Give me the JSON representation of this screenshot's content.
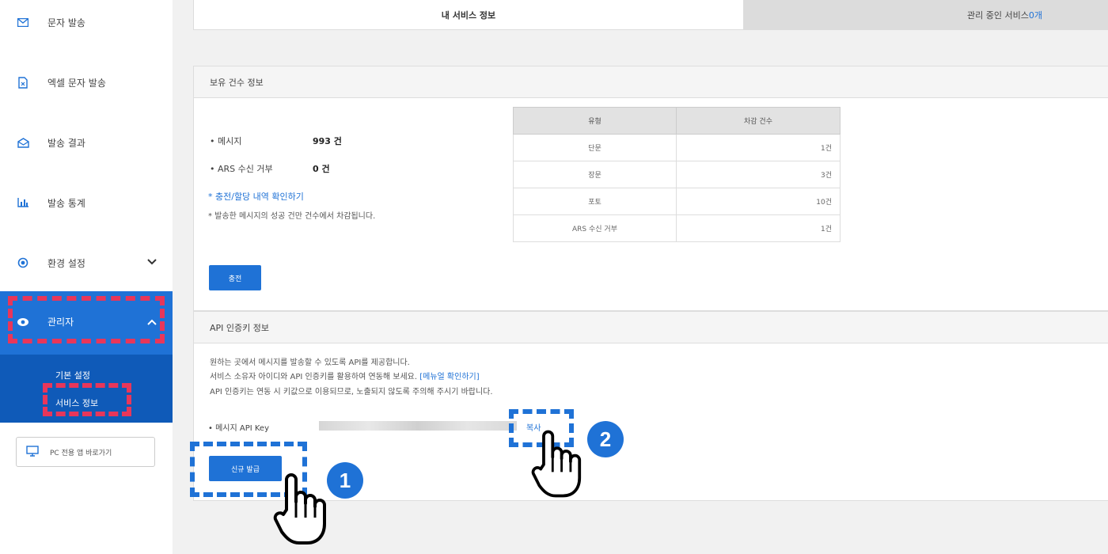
{
  "sidebar": {
    "items": [
      {
        "label": "문자 발송",
        "icon": "envelope-icon"
      },
      {
        "label": "엑셀 문자 발송",
        "icon": "excel-file-icon"
      },
      {
        "label": "발송 결과",
        "icon": "mail-open-icon"
      },
      {
        "label": "발송 통계",
        "icon": "bar-chart-icon"
      },
      {
        "label": "환경 설정",
        "icon": "settings-icon"
      },
      {
        "label": "관리자",
        "icon": "eye-icon"
      }
    ],
    "submenu": [
      "기본 설정",
      "서비스 정보"
    ],
    "pc_button": "PC 전용 앱 바로가기"
  },
  "tabs": {
    "active": "내 서비스 정보",
    "inactive_label": "관리 중인 서비스 ",
    "inactive_count": "0개"
  },
  "balance": {
    "title": "보유 건수 정보",
    "message_label": "• 메시지",
    "message_value": "993 건",
    "ars_label": "• ARS 수신 거부",
    "ars_value": "0 건",
    "history_link": "* 충전/할당 내역 확인하기",
    "note": "* 발송한 메시지의 성공 건만 건수에서 차감됩니다.",
    "charge_button": "충전",
    "table": {
      "headers": [
        "유형",
        "차감 건수"
      ],
      "rows": [
        {
          "type": "단문",
          "count": "1건"
        },
        {
          "type": "장문",
          "count": "3건"
        },
        {
          "type": "포토",
          "count": "10건"
        },
        {
          "type": "ARS 수신 거부",
          "count": "1건"
        }
      ]
    }
  },
  "api": {
    "title": "API 인증키 정보",
    "desc1": "원하는 곳에서 메시지를 발송할 수 있도록 API를 제공합니다.",
    "desc2": "서비스 소유자 아이디와 API 인증키를 활용하여 연동해 보세요.",
    "desc2_link": "[메뉴얼 확인하기]",
    "desc3": "API 인증키는 연동 시 키값으로 이용되므로, 노출되지 않도록 주의해 주시기 바랍니다.",
    "key_label": "• 메시지 API Key",
    "copy_label": "복사",
    "issue_button": "신규 발급"
  },
  "callouts": {
    "step1": "1",
    "step2": "2"
  },
  "colors": {
    "accent": "#1f72d6",
    "highlight": "#e8365a"
  }
}
